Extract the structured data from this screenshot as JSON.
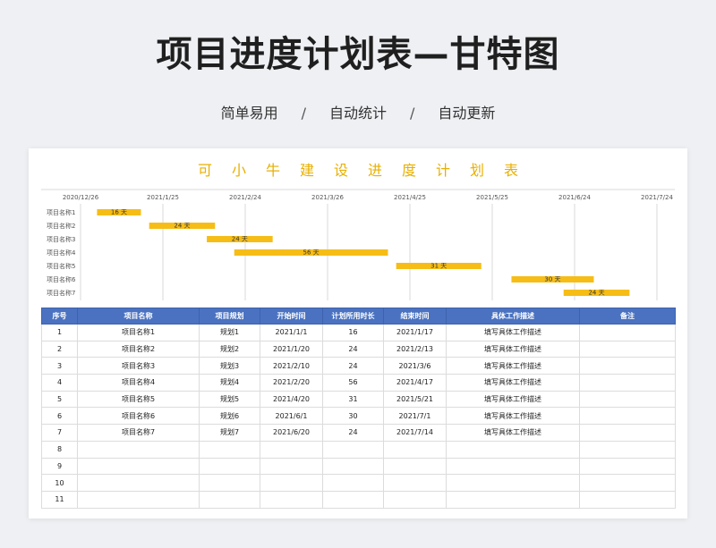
{
  "page": {
    "title": "项目进度计划表—甘特图",
    "tags": [
      "简单易用",
      "自动统计",
      "自动更新"
    ],
    "separator": "/"
  },
  "sheet": {
    "title": "可小牛建设进度计划表"
  },
  "chart_data": {
    "type": "bar",
    "orientation": "horizontal-gantt",
    "x_ticks": [
      "2020/12/26",
      "2021/1/25",
      "2021/2/24",
      "2021/3/26",
      "2021/4/25",
      "2021/5/25",
      "2021/6/24",
      "2021/7/24"
    ],
    "x_range": [
      "2020/12/26",
      "2021/7/24"
    ],
    "categories": [
      "项目名称1",
      "项目名称2",
      "项目名称3",
      "项目名称4",
      "项目名称5",
      "项目名称6",
      "项目名称7"
    ],
    "start": [
      "2021/1/1",
      "2021/1/20",
      "2021/2/10",
      "2021/2/20",
      "2021/4/20",
      "2021/6/1",
      "2021/6/20"
    ],
    "duration_days": [
      16,
      24,
      24,
      56,
      31,
      30,
      24
    ],
    "bar_labels": [
      "16 天",
      "24 天",
      "24 天",
      "56 天",
      "31 天",
      "30 天",
      "24 天"
    ],
    "bar_color": "#f6bd16",
    "grid": "vertical"
  },
  "table": {
    "headers": [
      "序号",
      "项目名称",
      "项目规划",
      "开始时间",
      "计划所用时长",
      "结束时间",
      "具体工作描述",
      "备注"
    ],
    "rows": [
      [
        "1",
        "项目名称1",
        "规划1",
        "2021/1/1",
        "16",
        "2021/1/17",
        "填写具体工作描述",
        ""
      ],
      [
        "2",
        "项目名称2",
        "规划2",
        "2021/1/20",
        "24",
        "2021/2/13",
        "填写具体工作描述",
        ""
      ],
      [
        "3",
        "项目名称3",
        "规划3",
        "2021/2/10",
        "24",
        "2021/3/6",
        "填写具体工作描述",
        ""
      ],
      [
        "4",
        "项目名称4",
        "规划4",
        "2021/2/20",
        "56",
        "2021/4/17",
        "填写具体工作描述",
        ""
      ],
      [
        "5",
        "项目名称5",
        "规划5",
        "2021/4/20",
        "31",
        "2021/5/21",
        "填写具体工作描述",
        ""
      ],
      [
        "6",
        "项目名称6",
        "规划6",
        "2021/6/1",
        "30",
        "2021/7/1",
        "填写具体工作描述",
        ""
      ],
      [
        "7",
        "项目名称7",
        "规划7",
        "2021/6/20",
        "24",
        "2021/7/14",
        "填写具体工作描述",
        ""
      ],
      [
        "8",
        "",
        "",
        "",
        "",
        "",
        "",
        ""
      ],
      [
        "9",
        "",
        "",
        "",
        "",
        "",
        "",
        ""
      ],
      [
        "10",
        "",
        "",
        "",
        "",
        "",
        "",
        ""
      ],
      [
        "11",
        "",
        "",
        "",
        "",
        "",
        "",
        ""
      ]
    ]
  }
}
